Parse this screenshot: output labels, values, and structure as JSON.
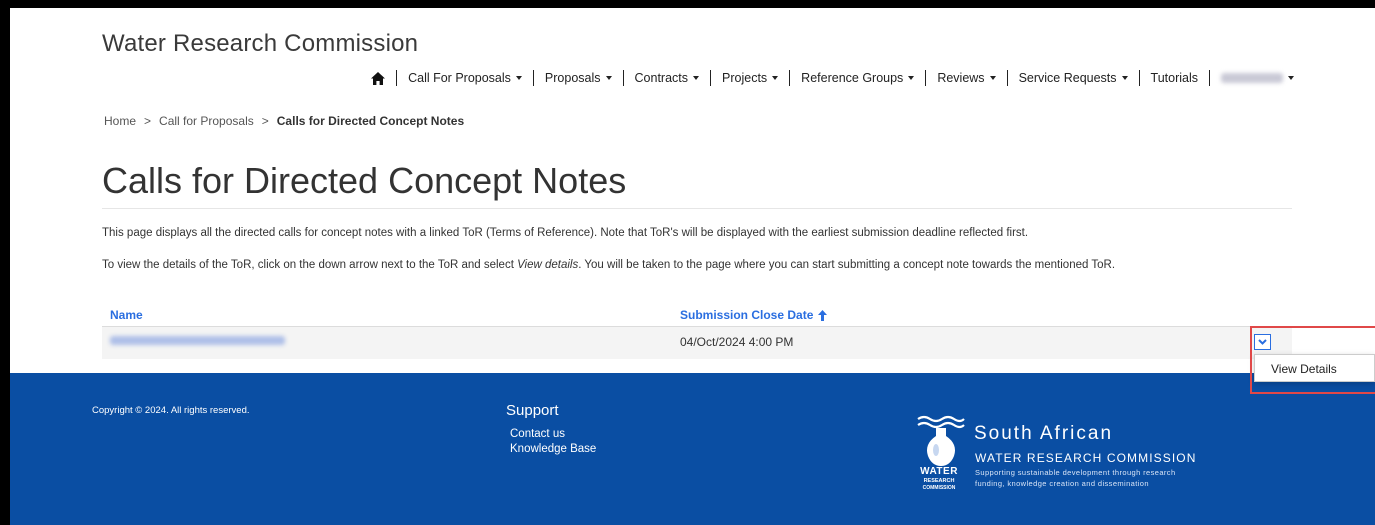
{
  "header": {
    "brand": "Water Research Commission",
    "nav": [
      {
        "label": "Call For Proposals"
      },
      {
        "label": "Proposals"
      },
      {
        "label": "Contracts"
      },
      {
        "label": "Projects"
      },
      {
        "label": "Reference Groups"
      },
      {
        "label": "Reviews"
      },
      {
        "label": "Service Requests"
      },
      {
        "label": "Tutorials"
      }
    ],
    "home_icon": "home-icon",
    "user_menu_icon": "caret-down-icon"
  },
  "breadcrumb": {
    "home": "Home",
    "parent": "Call for Proposals",
    "current": "Calls for Directed Concept Notes",
    "separator": ">"
  },
  "page": {
    "title": "Calls for Directed Concept Notes",
    "desc1": "This page displays all the directed calls for concept notes with a linked ToR (Terms of Reference). Note that ToR's will be displayed with the earliest submission deadline reflected first.",
    "desc2_before": "To view the details of the ToR, click on the down arrow next to the ToR and select ",
    "desc2_em": "View details",
    "desc2_after": ". You will be taken to the page where you can start submitting a concept note towards the mentioned ToR."
  },
  "table": {
    "columns": {
      "name": "Name",
      "date": "Submission Close Date"
    },
    "sort_icon": "arrow-up-icon",
    "rows": [
      {
        "date": "04/Oct/2024 4:00 PM"
      }
    ],
    "dropdown": {
      "toggle_icon": "chevron-down-icon",
      "item": "View Details"
    }
  },
  "footer": {
    "copyright": "Copyright © 2024. All rights reserved.",
    "support_title": "Support",
    "links": [
      "Contact us",
      "Knowledge Base"
    ],
    "logo": {
      "word1": "WATER",
      "word2": "RESEARCH",
      "word3": "COMMISSION",
      "line1": "South African",
      "line2": "WATER RESEARCH COMMISSION",
      "line3": "Supporting sustainable development through research",
      "line4": "funding, knowledge creation and dissemination"
    }
  },
  "colors": {
    "link": "#2a6ee0",
    "footer": "#0a4ea3",
    "highlight": "#e04848"
  }
}
